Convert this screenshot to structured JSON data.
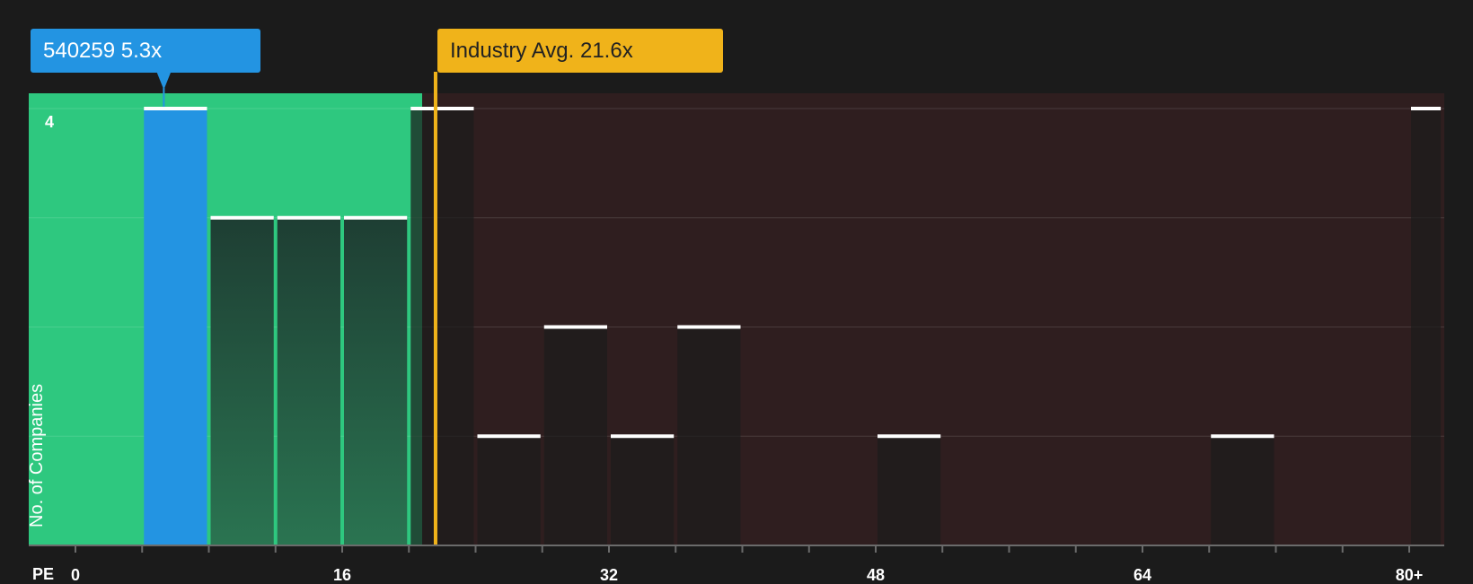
{
  "callouts": {
    "company": {
      "ticker": "540259",
      "value_label": "5.3x",
      "pe": 5.3
    },
    "industry": {
      "label": "Industry Avg.",
      "value_label": "21.6x",
      "pe": 21.6
    }
  },
  "chart_data": {
    "type": "bar",
    "title": "",
    "xlabel": "PE",
    "ylabel": "No. of Companies",
    "xlim": [
      0,
      82
    ],
    "ylim": [
      0,
      4
    ],
    "bin_width": 4,
    "bins": [
      {
        "x0": 4,
        "x1": 8,
        "count": 4,
        "highlight": true
      },
      {
        "x0": 8,
        "x1": 12,
        "count": 3
      },
      {
        "x0": 12,
        "x1": 16,
        "count": 3
      },
      {
        "x0": 16,
        "x1": 20,
        "count": 3
      },
      {
        "x0": 20,
        "x1": 24,
        "count": 4
      },
      {
        "x0": 24,
        "x1": 28,
        "count": 1
      },
      {
        "x0": 28,
        "x1": 32,
        "count": 2
      },
      {
        "x0": 32,
        "x1": 36,
        "count": 1
      },
      {
        "x0": 36,
        "x1": 40,
        "count": 2
      },
      {
        "x0": 48,
        "x1": 52,
        "count": 1
      },
      {
        "x0": 68,
        "x1": 72,
        "count": 1
      },
      {
        "x0": 80,
        "x1": 82,
        "count": 4
      }
    ],
    "x_tick_labels": [
      {
        "value": 0,
        "label": "0"
      },
      {
        "value": 16,
        "label": "16"
      },
      {
        "value": 32,
        "label": "32"
      },
      {
        "value": 48,
        "label": "48"
      },
      {
        "value": 64,
        "label": "64"
      },
      {
        "value": 80,
        "label": "80+"
      }
    ],
    "x_minor_ticks": [
      0,
      4,
      8,
      12,
      16,
      20,
      24,
      28,
      32,
      36,
      40,
      44,
      48,
      52,
      56,
      60,
      64,
      68,
      72,
      76,
      80
    ],
    "y_tick_labels": [
      {
        "value": 4,
        "label": "4"
      }
    ],
    "y_gridlines": [
      1,
      2,
      3,
      4
    ],
    "fair_range_max": 20.8,
    "colors": {
      "background": "#1b1b1b",
      "good_zone": "#2ec87f",
      "bad_zone": "#2f1e1f",
      "company_bar": "#2394e2",
      "industry_line": "#f0b31a",
      "bar_cap": "#ffffff"
    }
  }
}
